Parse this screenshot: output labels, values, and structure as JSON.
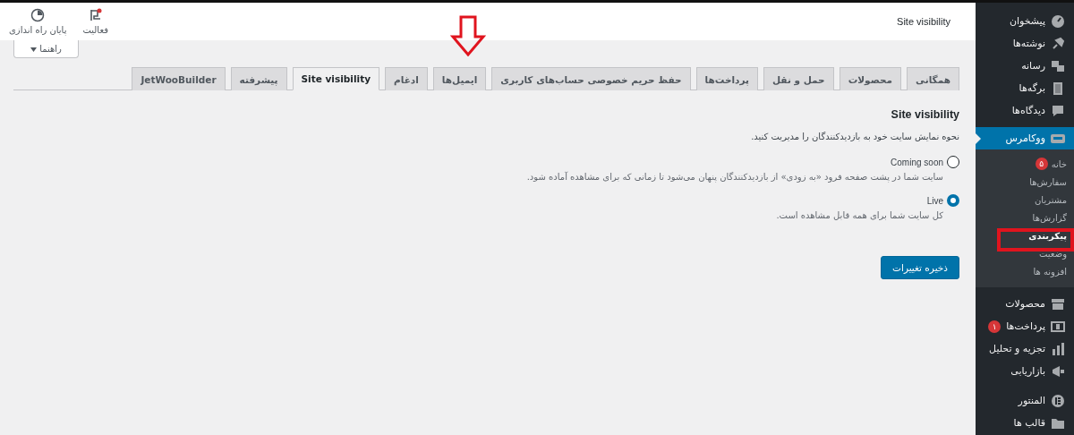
{
  "header": {
    "title": "Site visibility",
    "actions": [
      {
        "label": "فعالیت",
        "kind": "activity"
      },
      {
        "label": "پایان راه اندازی",
        "kind": "finish"
      }
    ],
    "help": {
      "label": "راهنما"
    }
  },
  "tabs": [
    {
      "label": "همگانی",
      "selected": false
    },
    {
      "label": "محصولات",
      "selected": false
    },
    {
      "label": "حمل و نقل",
      "selected": false
    },
    {
      "label": "پرداخت‌ها",
      "selected": false
    },
    {
      "label": "حفظ حریم خصوصی حساب‌های کاربری",
      "selected": false
    },
    {
      "label": "ایمیل‌ها",
      "selected": false
    },
    {
      "label": "ادغام",
      "selected": false
    },
    {
      "label": "Site visibility",
      "selected": true
    },
    {
      "label": "پیشرفته",
      "selected": false
    },
    {
      "label": "JetWooBuilder",
      "selected": false
    }
  ],
  "section": {
    "title": "Site visibility",
    "description": "نحوه نمایش سایت خود به بازدیدکنندگان را مدیریت کنید.",
    "options": [
      {
        "label": "Coming soon",
        "description": "سایت شما در پشت صفحه فرود «به زودی» از بازدیدکنندگان پنهان می‌شود تا زمانی که برای مشاهده آماده شود.",
        "selected": false
      },
      {
        "label": "Live",
        "description": "کل سایت شما برای همه قابل مشاهده است.",
        "selected": true
      }
    ]
  },
  "save_button": "ذخیره تغییرات",
  "sidebar": {
    "items": [
      {
        "label": "پیشخوان",
        "selected": false
      },
      {
        "label": "نوشته‌ها",
        "selected": false
      },
      {
        "label": "رسانه",
        "selected": false
      },
      {
        "label": "برگه‌ها",
        "selected": false
      },
      {
        "label": "دیدگاه‌ها",
        "selected": false
      },
      {
        "label": "ووکامرس",
        "selected": true,
        "children": [
          {
            "label": "خانه",
            "badge": "۵",
            "selected": false
          },
          {
            "label": "سفارش‌ها",
            "selected": false
          },
          {
            "label": "مشتریان",
            "selected": false
          },
          {
            "label": "گزارش‌ها",
            "selected": false
          },
          {
            "label": "پیکربندی",
            "selected": true
          },
          {
            "label": "وضعیت",
            "selected": false
          },
          {
            "label": "افزونه ها",
            "selected": false
          }
        ]
      },
      {
        "label": "محصولات",
        "selected": false
      },
      {
        "label": "پرداخت‌ها",
        "badge": "۱",
        "selected": false
      },
      {
        "label": "تجزیه و تحلیل",
        "selected": false
      },
      {
        "label": "بازاریابی",
        "selected": false
      },
      {
        "label": "المنتور",
        "selected": false
      },
      {
        "label": "قالب ها",
        "selected": false
      }
    ]
  }
}
